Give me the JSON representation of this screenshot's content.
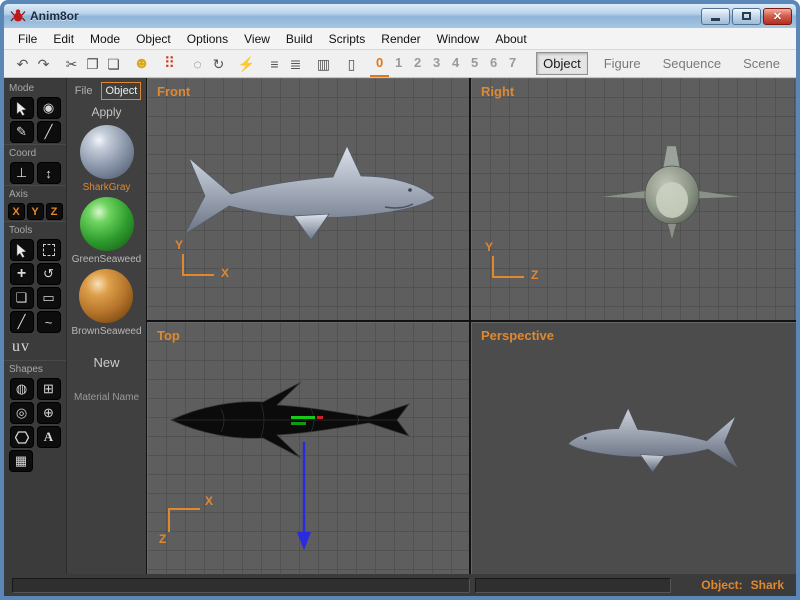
{
  "window": {
    "title": "Anim8or",
    "controls": {
      "close_glyph": "✕"
    }
  },
  "menu": {
    "items": [
      {
        "label": "File"
      },
      {
        "label": "Edit"
      },
      {
        "label": "Mode"
      },
      {
        "label": "Object"
      },
      {
        "label": "Options"
      },
      {
        "label": "View"
      },
      {
        "label": "Build"
      },
      {
        "label": "Scripts"
      },
      {
        "label": "Render"
      },
      {
        "label": "Window"
      },
      {
        "label": "About"
      }
    ]
  },
  "toolbar": {
    "icons": [
      {
        "name": "undo-icon",
        "glyph": "↶"
      },
      {
        "name": "redo-icon",
        "glyph": "↷"
      },
      {
        "name": "cut-icon",
        "glyph": "✂"
      },
      {
        "name": "copy-icon",
        "glyph": "❐"
      },
      {
        "name": "paste-icon",
        "glyph": "❏"
      },
      {
        "name": "smiley-icon",
        "glyph": "☻"
      },
      {
        "name": "dots-grid-icon",
        "glyph": "⠿"
      },
      {
        "name": "point-circle-icon",
        "glyph": "◌"
      },
      {
        "name": "rotate-view-icon",
        "glyph": "↻"
      },
      {
        "name": "lightning-icon",
        "glyph": "⚡"
      },
      {
        "name": "wireframe-list-icon",
        "glyph": "≡"
      },
      {
        "name": "shaded-list-icon",
        "glyph": "≣"
      },
      {
        "name": "chart-icon",
        "glyph": "▥"
      },
      {
        "name": "device-icon",
        "glyph": "▯"
      }
    ],
    "frames": [
      "0",
      "1",
      "2",
      "3",
      "4",
      "5",
      "6",
      "7"
    ],
    "active_frame": "0",
    "mode_tabs": [
      {
        "label": "Object",
        "active": true
      },
      {
        "label": "Figure",
        "active": false
      },
      {
        "label": "Sequence",
        "active": false
      },
      {
        "label": "Scene",
        "active": false
      }
    ]
  },
  "sidebar": {
    "labels": {
      "mode": "Mode",
      "coord": "Coord",
      "axis": "Axis",
      "tools": "Tools",
      "shapes": "Shapes",
      "uv": "uv"
    },
    "axis_buttons": [
      {
        "label": "X"
      },
      {
        "label": "Y"
      },
      {
        "label": "Z"
      }
    ],
    "icons": {
      "eye": "◉",
      "edit": "✎",
      "knife": "╱",
      "world_coord": "⊥",
      "screen_coord": "↕",
      "move": "+",
      "rotate": "↺",
      "scale": "❏",
      "stretch": "▭",
      "line": "╱",
      "curve": "~",
      "sphere": "◍",
      "gridded_sphere": "⊞",
      "torus": "◎",
      "geodesic": "⊕",
      "text": "A",
      "mesh": "▦"
    }
  },
  "materials": {
    "tabs": [
      {
        "label": "File",
        "active": false
      },
      {
        "label": "Object",
        "active": true
      }
    ],
    "apply_label": "Apply",
    "items": [
      {
        "name": "SharkGray",
        "color": "#8a96aa",
        "selected": true
      },
      {
        "name": "GreenSeaweed",
        "color": "#2f9e2f",
        "selected": false
      },
      {
        "name": "BrownSeaweed",
        "color": "#b5742a",
        "selected": false
      }
    ],
    "new_label": "New",
    "name_label": "Material Name"
  },
  "viewports": [
    {
      "name": "Front",
      "axis_v": "Y",
      "axis_h": "X"
    },
    {
      "name": "Right",
      "axis_v": "Y",
      "axis_h": "Z"
    },
    {
      "name": "Top",
      "axis_v": "Z",
      "axis_h": "X"
    },
    {
      "name": "Perspective"
    }
  ],
  "scene": {
    "object_name": "Shark"
  },
  "statusbar": {
    "object_label": "Object:",
    "object_value": "Shark"
  },
  "colors": {
    "accent_orange": "#e08830",
    "gizmo_blue": "#2a2ae0",
    "selection_green": "#19c819",
    "selection_red": "#d02020",
    "titlebar_blue": "#8fb4d8"
  }
}
